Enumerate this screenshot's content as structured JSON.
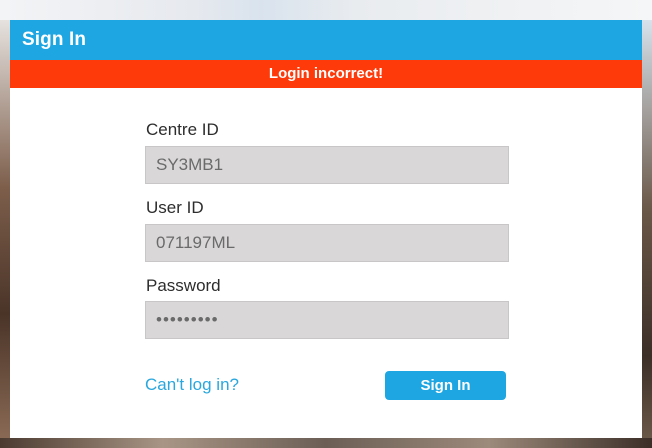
{
  "header": {
    "title": "Sign In"
  },
  "alert": {
    "message": "Login incorrect!"
  },
  "form": {
    "centre_id": {
      "label": "Centre ID",
      "value": "SY3MB1"
    },
    "user_id": {
      "label": "User ID",
      "value": "071197ML"
    },
    "password": {
      "label": "Password",
      "value": "123456789"
    }
  },
  "footer": {
    "cant_login_label": "Can't log in?",
    "submit_label": "Sign In"
  },
  "colors": {
    "header_blue": "#1ea6e2",
    "error_red": "#ff3a0a",
    "link_blue": "#29a7de",
    "input_gray": "#d9d7d7"
  }
}
